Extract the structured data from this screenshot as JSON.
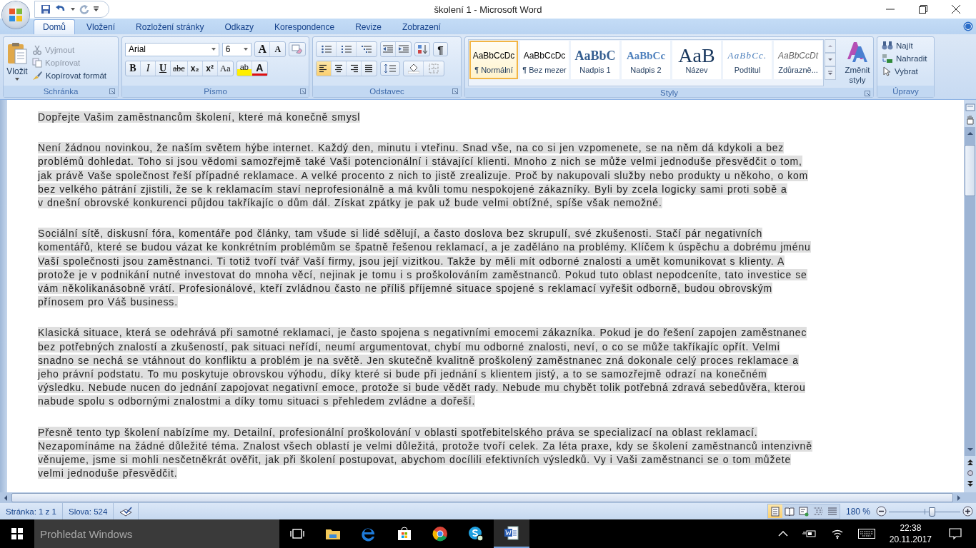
{
  "window": {
    "title": "školení 1 - Microsoft Word"
  },
  "tabs": [
    {
      "label": "Domů",
      "selected": true
    },
    {
      "label": "Vložení",
      "selected": false
    },
    {
      "label": "Rozložení stránky",
      "selected": false
    },
    {
      "label": "Odkazy",
      "selected": false
    },
    {
      "label": "Korespondence",
      "selected": false
    },
    {
      "label": "Revize",
      "selected": false
    },
    {
      "label": "Zobrazení",
      "selected": false
    }
  ],
  "ribbon": {
    "clipboard": {
      "label": "Schránka",
      "paste": "Vložit",
      "cut": {
        "label": "Vyjmout",
        "disabled": true
      },
      "copy": {
        "label": "Kopírovat",
        "disabled": true
      },
      "format_painter": {
        "label": "Kopírovat formát",
        "disabled": false
      }
    },
    "font": {
      "label": "Písmo",
      "family": "Arial",
      "size": "6",
      "grow": "A",
      "shrink": "A",
      "format_buttons": [
        {
          "label": "B",
          "kind": "bold"
        },
        {
          "label": "I",
          "kind": "italic"
        },
        {
          "label": "U",
          "kind": "underline"
        },
        {
          "label": "abc",
          "kind": "strike"
        },
        {
          "label": "x₂",
          "kind": "sub"
        },
        {
          "label": "x²",
          "kind": "sup"
        },
        {
          "label": "Aa",
          "kind": "case"
        }
      ],
      "highlight": "ab",
      "font_color": "A"
    },
    "paragraph": {
      "label": "Odstavec",
      "show_marks": "¶",
      "alignments": [
        {
          "kind": "left",
          "selected": true
        },
        {
          "kind": "center",
          "selected": false
        },
        {
          "kind": "right",
          "selected": false
        },
        {
          "kind": "justify",
          "selected": false
        }
      ]
    },
    "styles": {
      "label": "Styly",
      "items": [
        {
          "preview": "AaBbCcDc",
          "name": "¶ Normální",
          "kind": "normal",
          "selected": true
        },
        {
          "preview": "AaBbCcDc",
          "name": "¶ Bez mezer",
          "kind": "normal",
          "selected": false
        },
        {
          "preview": "AaBbC",
          "name": "Nadpis 1",
          "kind": "heading1",
          "selected": false
        },
        {
          "preview": "AaBbCc",
          "name": "Nadpis 2",
          "kind": "heading2",
          "selected": false
        },
        {
          "preview": "AaB",
          "name": "Název",
          "kind": "title",
          "selected": false
        },
        {
          "preview": "AaBbCc.",
          "name": "Podtitul",
          "kind": "subtitle",
          "selected": false
        },
        {
          "preview": "AaBbCcDt",
          "name": "Zdůrazně...",
          "kind": "emphasis",
          "selected": false
        }
      ],
      "change_styles": "Změnit styly"
    },
    "editing": {
      "label": "Úpravy",
      "find": "Najít",
      "replace": "Nahradit",
      "select": "Vybrat"
    }
  },
  "document": {
    "paragraphs": [
      {
        "lines": [
          "Dopřejte Vašim zaměstnancům školení, které má konečně smysl"
        ]
      },
      {
        "lines": [
          "Není žádnou novinkou, že naším světem hýbe internet. Každý den, minutu i vteřinu. Snad vše, na co si jen vzpomenete, se na něm dá kdykoli a bez",
          "problémů dohledat. Toho si jsou vědomi samozřejmě také Vaši potencionální i stávající klienti. Mnoho z nich se může velmi jednoduše přesvědčit o tom,",
          "jak právě Vaše společnost řeší případné reklamace. A velké procento z nich to jistě zrealizuje. Proč by nakupovali služby nebo produkty u někoho, o kom",
          "bez velkého pátrání zjistili, že se k reklamacím staví neprofesionálně a má kvůli tomu nespokojené zákazníky. Byli by zcela logicky sami proti sobě a",
          "v dnešní obrovské konkurenci půjdou takříkajíc o dům dál. Získat zpátky je pak už bude velmi obtížné, spíše však nemožné."
        ]
      },
      {
        "lines": [
          "Sociální sítě, diskusní fóra, komentáře pod články, tam všude si lidé sdělují, a často doslova bez skrupulí, své zkušenosti. Stačí pár negativních",
          "komentářů, které se budou vázat ke konkrétním problémům se špatně řešenou reklamací, a je zaděláno na problémy. Klíčem k úspěchu a dobrému jménu",
          "Vaší společnosti jsou zaměstnanci. Ti totiž tvoří tvář Vaší firmy, jsou její vizitkou. Takže by měli mít odborné znalosti a umět komunikovat s klienty. A",
          "protože je v podnikání nutné investovat do mnoha věcí, nejinak je tomu i s proškolováním zaměstnanců. Pokud tuto oblast nepodceníte, tato investice se",
          "vám několikanásobně vrátí. Profesionálové, kteří zvládnou často ne příliš příjemné situace spojené s reklamací vyřešit odborně, budou obrovským",
          "přínosem pro Váš business."
        ]
      },
      {
        "lines": [
          "Klasická situace, která se odehrává při samotné reklamaci, je často spojena s negativními emocemi zákazníka. Pokud je do řešení zapojen zaměstnanec",
          "bez potřebných znalostí a zkušeností, pak situaci neřídí, neumí argumentovat, chybí mu odborné znalosti, neví, o co se může takříkajíc opřít. Velmi",
          "snadno se nechá se vtáhnout do konfliktu a problém je na světě. Jen skutečně kvalitně proškolený zaměstnanec zná dokonale celý proces reklamace a",
          "jeho právní podstatu. To mu poskytuje obrovskou výhodu, díky které si bude při jednání s klientem jistý, a to se samozřejmě odrazí na konečném",
          "výsledku. Nebude nucen do jednání zapojovat negativní emoce, protože si bude vědět rady. Nebude mu chybět tolik potřebná zdravá sebedůvěra, kterou",
          "nabude spolu s odbornými znalostmi a díky tomu situaci s přehledem zvládne a dořeší."
        ]
      },
      {
        "lines": [
          "Přesně tento typ školení nabízíme my. Detailní, profesionální proškolování v oblasti spotřebitelského práva se specializací na oblast reklamací.",
          "Nezapomínáme na žádné důležité téma. Znalost všech oblastí je velmi důležitá, protože tvoří celek. Za léta praxe, kdy se školení zaměstnanců intenzivně",
          "věnujeme, jsme si mohli nesčetněkrát ověřit, jak při školení postupovat, abychom docílili efektivních výsledků. Vy i Vaši zaměstnanci se o tom můžete",
          "velmi jednoduše přesvědčit."
        ]
      }
    ]
  },
  "status_bar": {
    "page": "Stránka: 1 z 1",
    "words": "Slova: 524",
    "views": [
      {
        "kind": "print",
        "selected": true
      },
      {
        "kind": "reading",
        "selected": false
      },
      {
        "kind": "web",
        "selected": false
      },
      {
        "kind": "outline",
        "selected": false
      },
      {
        "kind": "draft",
        "selected": false
      }
    ],
    "zoom": "180 %",
    "zoom_slider": {
      "level": 0.6
    }
  },
  "taskbar": {
    "search_placeholder": "Prohledat Windows",
    "time": "22:38",
    "date": "20.11.2017"
  }
}
